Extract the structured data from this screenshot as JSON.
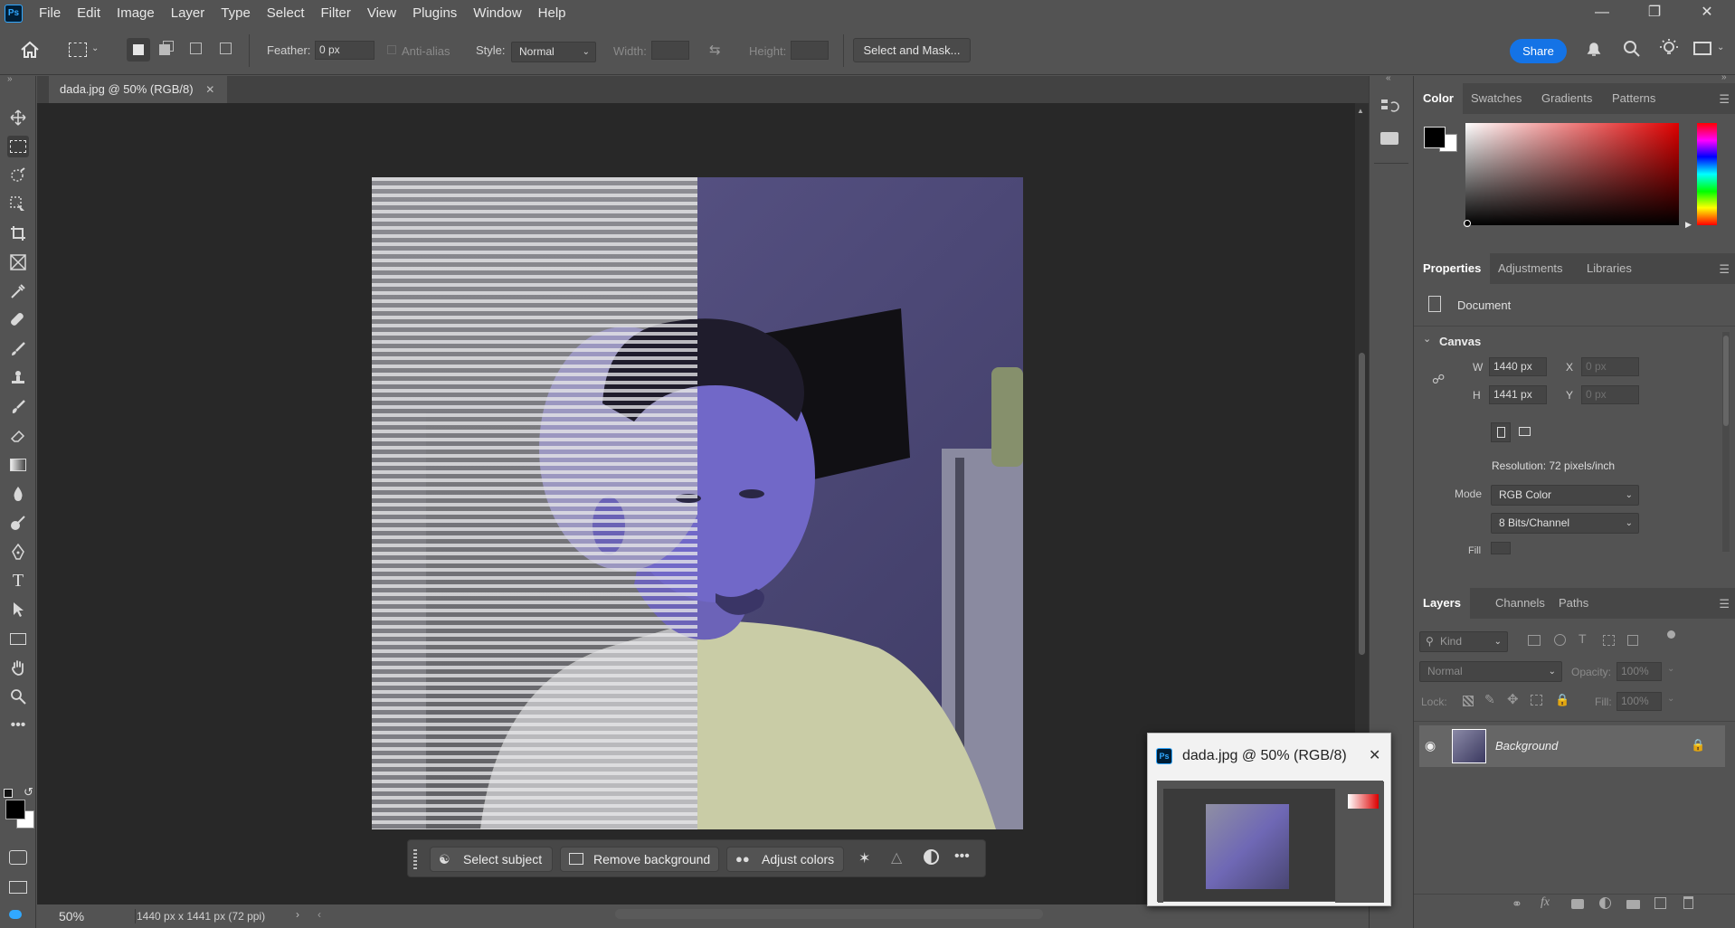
{
  "menubar": {
    "items": [
      "File",
      "Edit",
      "Image",
      "Layer",
      "Type",
      "Select",
      "Filter",
      "View",
      "Plugins",
      "Window",
      "Help"
    ],
    "logo": "Ps"
  },
  "options": {
    "feather_label": "Feather:",
    "feather_value": "0 px",
    "antialias_label": "Anti-alias",
    "style_label": "Style:",
    "style_value": "Normal",
    "width_label": "Width:",
    "height_label": "Height:",
    "select_mask_label": "Select and Mask...",
    "share_label": "Share"
  },
  "document": {
    "tab_title": "dada.jpg @ 50% (RGB/8)",
    "zoom": "50%",
    "status": "1440 px x 1441 px (72 ppi)"
  },
  "taskbar": {
    "select_subject": "Select subject",
    "remove_background": "Remove background",
    "adjust_colors": "Adjust colors"
  },
  "color_panel": {
    "tabs": [
      "Color",
      "Swatches",
      "Gradients",
      "Patterns"
    ],
    "foreground": "#000000",
    "background": "#ffffff"
  },
  "properties_panel": {
    "tabs": [
      "Properties",
      "Adjustments",
      "Libraries"
    ],
    "doc_label": "Document",
    "canvas_label": "Canvas",
    "w_label": "W",
    "w_value": "1440 px",
    "h_label": "H",
    "h_value": "1441 px",
    "x_label": "X",
    "x_placeholder": "0 px",
    "y_label": "Y",
    "y_placeholder": "0 px",
    "resolution": "Resolution: 72 pixels/inch",
    "mode_label": "Mode",
    "mode_value": "RGB Color",
    "bits_value": "8 Bits/Channel",
    "fill_label": "Fill"
  },
  "layers_panel": {
    "tabs": [
      "Layers",
      "Channels",
      "Paths"
    ],
    "kind_placeholder": "Kind",
    "blend_mode": "Normal",
    "opacity_label": "Opacity:",
    "opacity_value": "100%",
    "lock_label": "Lock:",
    "fill_label": "Fill:",
    "fill_value": "100%",
    "layer_name": "Background"
  },
  "navigator": {
    "title": "dada.jpg @ 50% (RGB/8)"
  }
}
